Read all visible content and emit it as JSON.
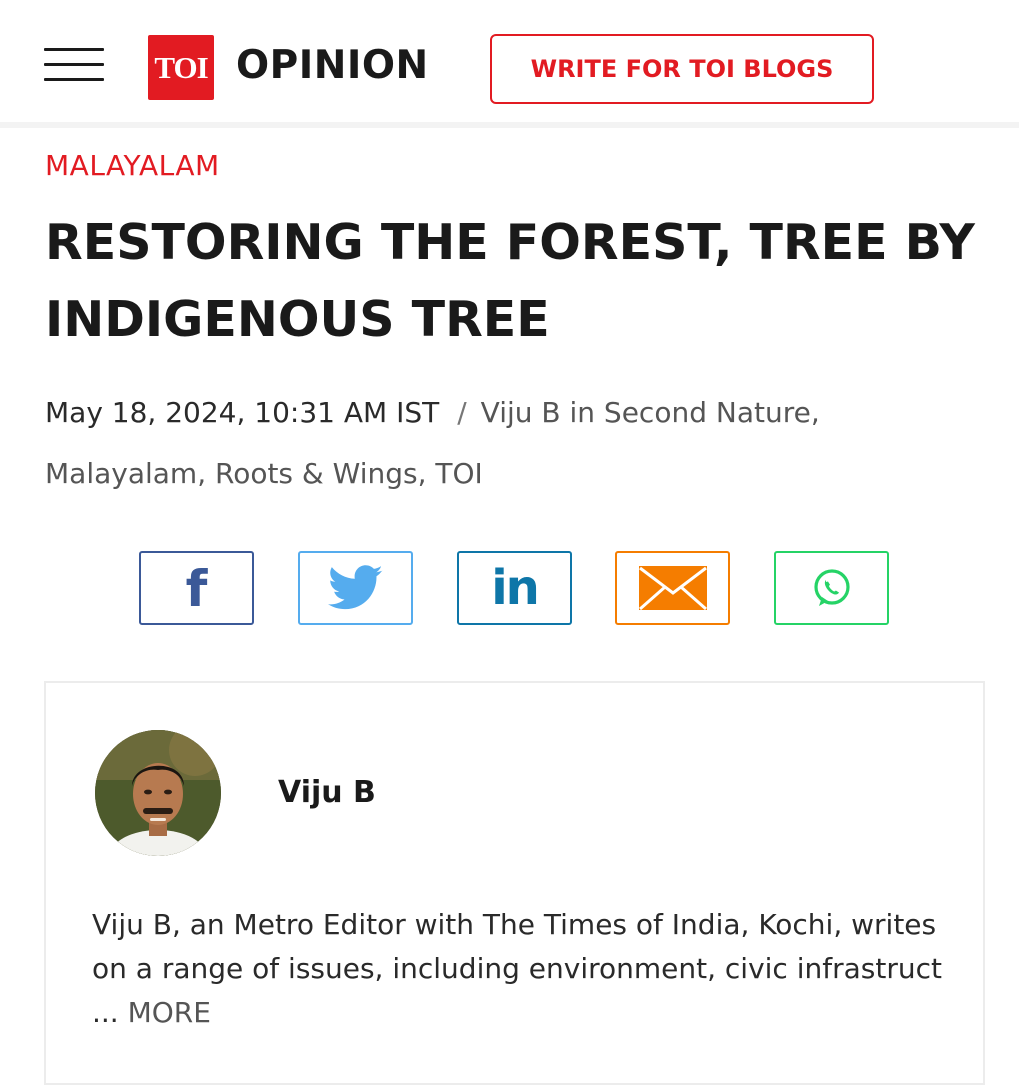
{
  "header": {
    "logo_text": "TOI",
    "section_title": "OPINION",
    "write_button_label": "WRITE FOR TOI BLOGS"
  },
  "article": {
    "category": "MALAYALAM",
    "headline": "RESTORING THE FOREST, TREE BY INDIGENOUS TREE",
    "date": "May 18, 2024, 10:31 AM IST",
    "separator": "/",
    "byline": "Viju B in Second Nature, Malayalam, Roots & Wings, TOI"
  },
  "share": {
    "facebook_label": "f",
    "linkedin_label": "in",
    "icons": [
      "facebook-icon",
      "twitter-icon",
      "linkedin-icon",
      "email-icon",
      "whatsapp-icon"
    ]
  },
  "author": {
    "name": "Viju B",
    "bio": "Viju B, an Metro Editor with The Times of India, Kochi, writes on a range of issues, including environment, civic infrastruct",
    "ellipsis": " ... ",
    "more_label": "MORE"
  },
  "colors": {
    "brand_red": "#e21b22",
    "facebook": "#3b5998",
    "twitter": "#55acee",
    "linkedin": "#0e76a8",
    "email": "#f57d00",
    "whatsapp": "#25d366"
  }
}
